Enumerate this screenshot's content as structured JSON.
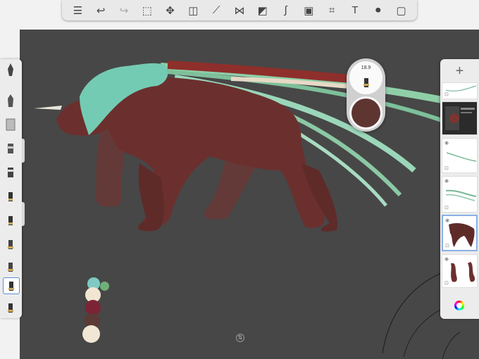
{
  "toolbar": {
    "icons": [
      "gallery-icon",
      "undo-icon",
      "redo-icon",
      "selection-icon",
      "transform-icon",
      "fill-icon",
      "ruler-icon",
      "symmetry-icon",
      "shapes-icon",
      "stroke-icon",
      "image-icon",
      "perspective-icon",
      "text-icon",
      "record-icon",
      "fullscreen-icon"
    ]
  },
  "brush_puck": {
    "size_value": "18.9",
    "color": "#5e3531"
  },
  "layers": {
    "add_label": "+",
    "selected_index": 4
  },
  "recent_colors": [
    "#7fc9c3",
    "#6fb079",
    "#f1e6d2",
    "#7c2436",
    "#5c3a35",
    "#f1e7d4"
  ],
  "colors": {
    "canvas": "#474747",
    "accent": "#5b8fd6"
  }
}
